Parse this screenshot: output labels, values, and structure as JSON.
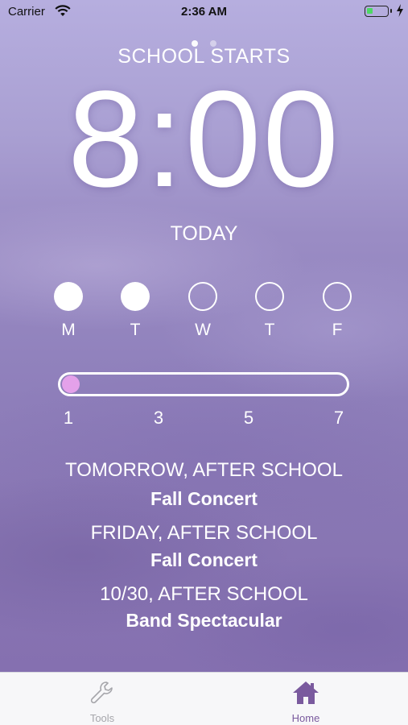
{
  "status_bar": {
    "carrier": "Carrier",
    "time": "2:36 AM",
    "battery_level": 0.3
  },
  "page_indicator": {
    "pages": 2,
    "current": 1
  },
  "header": {
    "label": "SCHOOL STARTS",
    "start_time": "8:00",
    "day_label": "TODAY"
  },
  "week": {
    "days": [
      {
        "letter": "M",
        "filled": true
      },
      {
        "letter": "T",
        "filled": true
      },
      {
        "letter": "W",
        "filled": false
      },
      {
        "letter": "T",
        "filled": false
      },
      {
        "letter": "F",
        "filled": false
      }
    ]
  },
  "slider": {
    "value": 1,
    "min": 1,
    "max": 7,
    "tick_labels": [
      "1",
      "3",
      "5",
      "7"
    ]
  },
  "events": [
    {
      "when": "TOMORROW, AFTER SCHOOL",
      "name": "Fall Concert"
    },
    {
      "when": "FRIDAY, AFTER SCHOOL",
      "name": "Fall Concert"
    },
    {
      "when": "10/30, AFTER SCHOOL",
      "name": "Band Spectacular"
    }
  ],
  "tab_bar": {
    "tabs": [
      {
        "label": "Tools",
        "icon": "wrench-icon",
        "active": false
      },
      {
        "label": "Home",
        "icon": "home-icon",
        "active": true
      }
    ],
    "active_color": "#7a5a9e",
    "inactive_color": "#a6a6ab"
  }
}
